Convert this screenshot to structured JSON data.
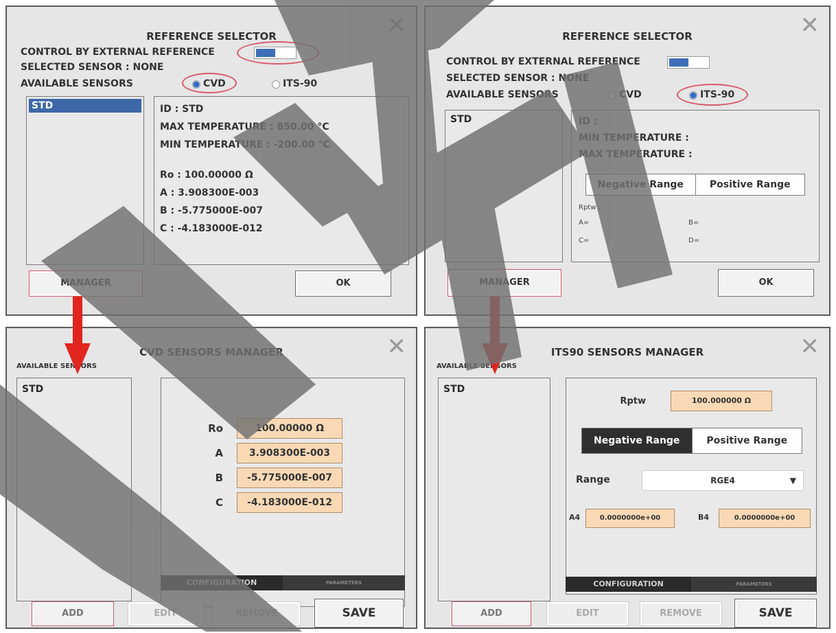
{
  "colors": {
    "panel_bg": "#e6e6e6",
    "selection": "#3d68a8",
    "field_bg": "#f9d9b5",
    "arrow": "#e0261f",
    "highlight_ring": "#d85a6a",
    "watermark": "#707070"
  },
  "icons": {
    "close": "✕",
    "dropdown": "▼"
  },
  "ref1": {
    "title": "REFERENCE SELECTOR",
    "control_label": "CONTROL BY EXTERNAL REFERENCE",
    "selected_sensor": "SELECTED SENSOR : NONE",
    "available_label": "AVAILABLE SENSORS",
    "radio_cvd": "CVD",
    "radio_its": "ITS-90",
    "list_items": [
      "STD"
    ],
    "id": "ID : STD",
    "max_temp": "MAX TEMPERATURE : 850.00 °C",
    "min_temp": "MIN TEMPERATURE : -200.00 °C",
    "ro": "Ro : 100.00000 Ω",
    "a": "A : 3.908300E-003",
    "b": "B : -5.775000E-007",
    "c": "C : -4.183000E-012",
    "manager": "MANAGER",
    "ok": "OK"
  },
  "ref2": {
    "title": "REFERENCE SELECTOR",
    "control_label": "CONTROL BY EXTERNAL REFERENCE",
    "selected_sensor": "SELECTED SENSOR : NONE",
    "available_label": "AVAILABLE SENSORS",
    "radio_cvd": "CVD",
    "radio_its": "ITS-90",
    "list_items": [
      "STD"
    ],
    "id": "ID :",
    "min_temp": "MIN TEMPERATURE :",
    "max_temp": "MAX TEMPERATURE :",
    "neg_range": "Negative Range",
    "pos_range": "Positive Range",
    "rptw": "Rptw :",
    "a": "A=",
    "b": "B=",
    "c": "C=",
    "d": "D=",
    "manager": "MANAGER",
    "ok": "OK"
  },
  "cvd": {
    "title": "CVD SENSORS MANAGER",
    "available_label": "AVAILABLE SENSORS",
    "list_items": [
      "STD"
    ],
    "params": [
      {
        "label": "Ro",
        "value": "100.00000 Ω"
      },
      {
        "label": "A",
        "value": "3.908300E-003"
      },
      {
        "label": "B",
        "value": "-5.775000E-007"
      },
      {
        "label": "C",
        "value": "-4.183000E-012"
      }
    ],
    "tab_config": "CONFIGURATION",
    "tab_params": "PARAMETERS",
    "add": "ADD",
    "edit": "EDIT",
    "remove": "REMOVE",
    "save": "SAVE"
  },
  "its": {
    "title": "ITS90 SENSORS MANAGER",
    "available_label": "AVAILABLE SENSORS",
    "list_items": [
      "STD"
    ],
    "rptw_label": "Rptw",
    "rptw_value": "100.000000 Ω",
    "neg_range": "Negative Range",
    "pos_range": "Positive Range",
    "range_label": "Range",
    "range_value": "RGE4",
    "a4_label": "A4",
    "a4_value": "0.0000000e+00",
    "b4_label": "B4",
    "b4_value": "0.0000000e+00",
    "tab_config": "CONFIGURATION",
    "tab_params": "PARAMETERS",
    "add": "ADD",
    "edit": "EDIT",
    "remove": "REMOVE",
    "save": "SAVE"
  }
}
